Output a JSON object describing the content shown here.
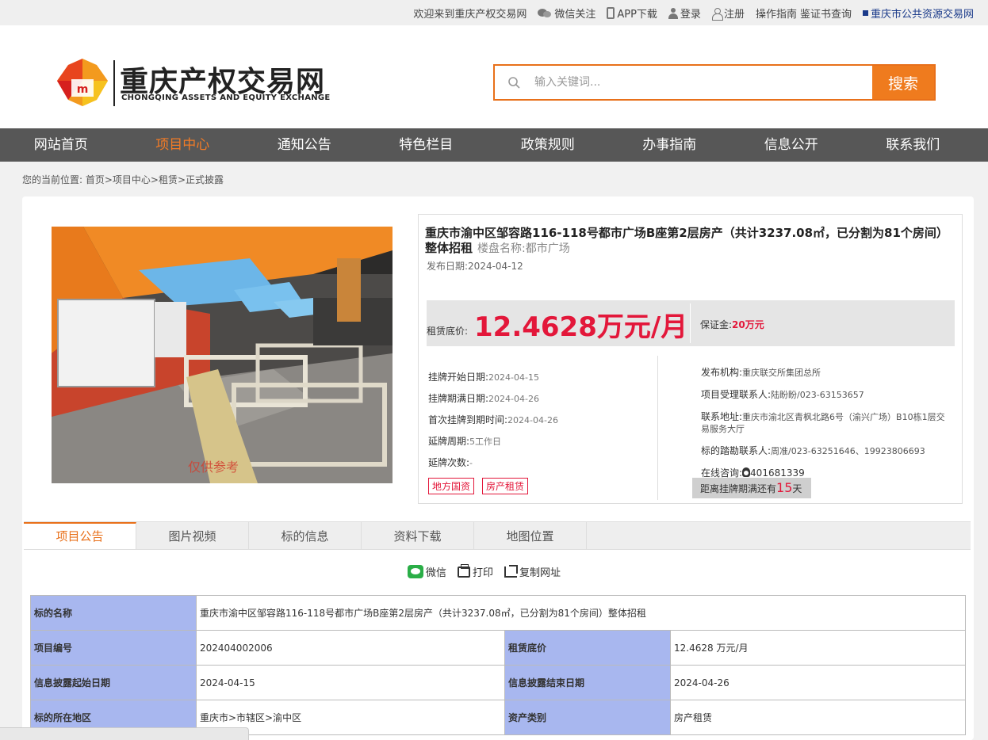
{
  "topbar": {
    "welcome": "欢迎来到重庆产权交易网",
    "wechat": "微信关注",
    "app": "APP下载",
    "login": "登录",
    "register": "注册",
    "guide": "操作指南",
    "cert": "鉴证书查询",
    "public": "重庆市公共资源交易网"
  },
  "header": {
    "logo_cn": "重庆产权交易网",
    "logo_en": "CHONGQING ASSETS AND EQUITY EXCHANGE",
    "search_placeholder": "输入关键词...",
    "search_button": "搜索"
  },
  "nav": {
    "items": [
      "网站首页",
      "项目中心",
      "通知公告",
      "特色栏目",
      "政策规则",
      "办事指南",
      "信息公开",
      "联系我们"
    ],
    "active_index": 1
  },
  "breadcrumb": "您的当前位置: 首页>项目中心>租赁>正式披露",
  "photo": {
    "watermark": "仅供参考"
  },
  "project": {
    "title": "重庆市渝中区邹容路116-118号都市广场B座第2层房产（共计3237.08㎡，已分割为81个房间）整体招租",
    "building": "楼盘名称:都市广场",
    "publish_date": "发布日期:2024-04-12",
    "price_label": "租赁底价:",
    "price_value": "12.4628万元/月",
    "deposit_label": "保证金:",
    "deposit_value": "20万元",
    "left": [
      {
        "label": "挂牌开始日期:",
        "value": "2024-04-15"
      },
      {
        "label": "挂牌期满日期:",
        "value": "2024-04-26"
      },
      {
        "label": "首次挂牌到期时间:",
        "value": "2024-04-26"
      },
      {
        "label": "延牌周期:",
        "value": "5工作日"
      },
      {
        "label": "延牌次数:",
        "value": "-"
      }
    ],
    "tags": [
      "地方国资",
      "房产租赁"
    ],
    "right": [
      {
        "label": "发布机构:",
        "value": "重庆联交所集团总所"
      },
      {
        "label": "项目受理联系人:",
        "value": "陆盼盼/023-63153657"
      },
      {
        "label": "联系地址:",
        "value": "重庆市渝北区青枫北路6号（渝兴广场）B10栋1层交易服务大厅"
      },
      {
        "label": "标的踏勘联系人:",
        "value": "周准/023-63251646、19923806693"
      }
    ],
    "qq_label": "在线咨询:",
    "qq_value": "401681339",
    "countdown_prefix": "距离挂牌期满还有",
    "countdown_days": "15",
    "countdown_suffix": "天"
  },
  "tabs": [
    "项目公告",
    "图片视频",
    "标的信息",
    "资料下载",
    "地图位置"
  ],
  "share": {
    "wechat": "微信",
    "print": "打印",
    "copy": "复制网址"
  },
  "detail": {
    "name_label": "标的名称",
    "name_value": "重庆市渝中区邹容路116-118号都市广场B座第2层房产（共计3237.08㎡，已分割为81个房间）整体招租",
    "rows": [
      {
        "k1": "项目编号",
        "v1": "202404002006",
        "k2": "租赁底价",
        "v2": "12.4628 万元/月"
      },
      {
        "k1": "信息披露起始日期",
        "v1": "2024-04-15",
        "k2": "信息披露结束日期",
        "v2": "2024-04-26"
      },
      {
        "k1": "标的所在地区",
        "v1": "重庆市>市辖区>渝中区",
        "k2": "资产类别",
        "v2": "房产租赁"
      }
    ]
  },
  "colors": {
    "accent": "#ef7b1e",
    "price": "#e3173a",
    "nav_bg": "#575757",
    "table_key_bg": "#a8b7ef"
  }
}
